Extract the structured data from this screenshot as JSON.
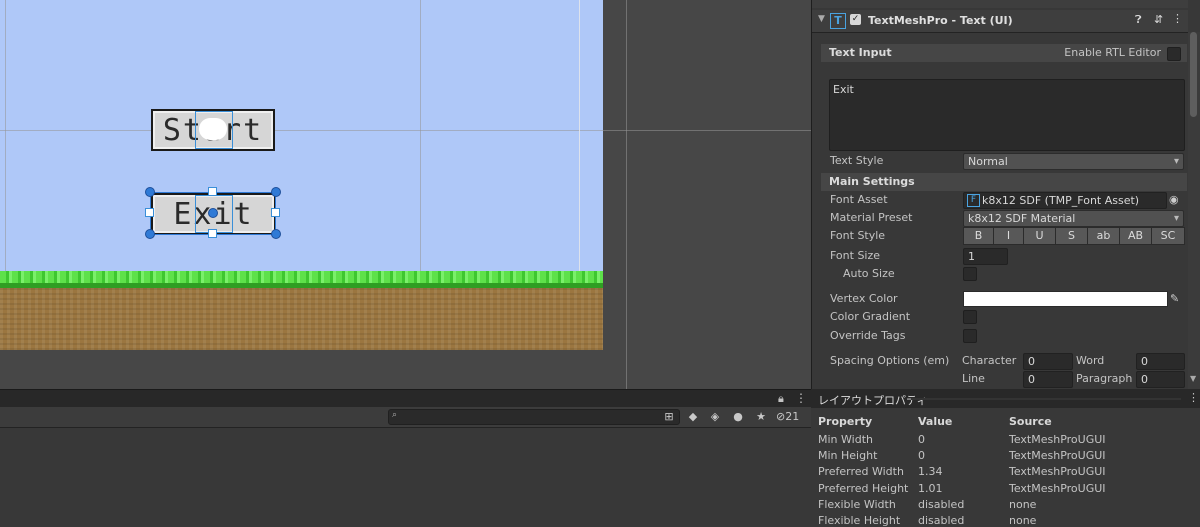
{
  "scene": {
    "start_button_text": "Start",
    "exit_button_text": "Exit",
    "colors": {
      "sky": "#afc8f8",
      "grass": "#5ee14a",
      "dirt": "#9b7640",
      "selection": "#3a8fd8"
    }
  },
  "inspector": {
    "component_title": "TextMeshPro - Text (UI)",
    "component_icon": "T",
    "text_input_label": "Text Input",
    "enable_rtl_label": "Enable RTL Editor",
    "text_value": "Exit",
    "text_style_label": "Text Style",
    "text_style_value": "Normal",
    "main_settings_label": "Main Settings",
    "font_asset_label": "Font Asset",
    "font_asset_value": "k8x12 SDF (TMP_Font Asset)",
    "font_asset_icon": "F",
    "material_preset_label": "Material Preset",
    "material_preset_value": "k8x12 SDF Material",
    "font_style_label": "Font Style",
    "font_style_buttons": [
      "B",
      "I",
      "U",
      "S",
      "ab",
      "AB",
      "SC"
    ],
    "font_size_label": "Font Size",
    "font_size_value": "1",
    "auto_size_label": "Auto Size",
    "vertex_color_label": "Vertex Color",
    "color_gradient_label": "Color Gradient",
    "override_tags_label": "Override Tags",
    "spacing_label": "Spacing Options (em)",
    "spacing": {
      "character_label": "Character",
      "character_value": "0",
      "word_label": "Word",
      "word_value": "0",
      "line_label": "Line",
      "line_value": "0",
      "paragraph_label": "Paragraph",
      "paragraph_value": "0"
    }
  },
  "hierarchy": {
    "visibility_count": "21"
  },
  "layout_properties": {
    "title": "レイアウトプロパティ",
    "headers": {
      "property": "Property",
      "value": "Value",
      "source": "Source"
    },
    "rows": [
      {
        "property": "Min Width",
        "value": "0",
        "source": "TextMeshProUGUI"
      },
      {
        "property": "Min Height",
        "value": "0",
        "source": "TextMeshProUGUI"
      },
      {
        "property": "Preferred Width",
        "value": "1.34",
        "source": "TextMeshProUGUI"
      },
      {
        "property": "Preferred Height",
        "value": "1.01",
        "source": "TextMeshProUGUI"
      },
      {
        "property": "Flexible Width",
        "value": "disabled",
        "source": "none"
      },
      {
        "property": "Flexible Height",
        "value": "disabled",
        "source": "none"
      }
    ]
  }
}
